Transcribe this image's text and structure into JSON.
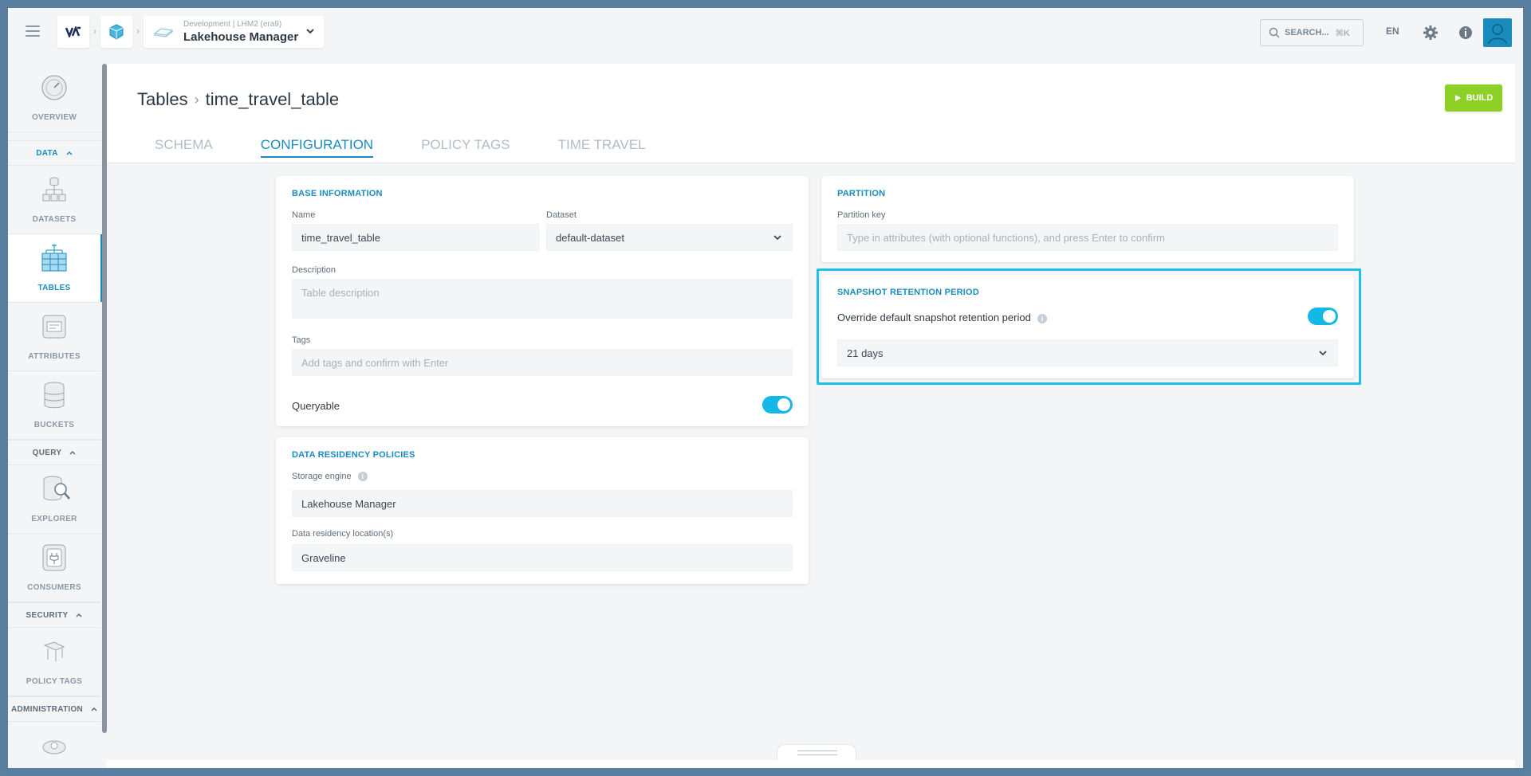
{
  "topbar": {
    "environment": "Development | LHM2 (era9)",
    "project": "Lakehouse Manager",
    "search_placeholder": "SEARCH...",
    "search_shortcut": "⌘K",
    "language": "EN"
  },
  "sidebar": {
    "items": [
      {
        "label": "OVERVIEW"
      },
      {
        "label": "DATASETS"
      },
      {
        "label": "TABLES"
      },
      {
        "label": "ATTRIBUTES"
      },
      {
        "label": "BUCKETS"
      },
      {
        "label": "EXPLORER"
      },
      {
        "label": "CONSUMERS"
      },
      {
        "label": "POLICY TAGS"
      }
    ],
    "sections": {
      "data": "DATA",
      "query": "QUERY",
      "security": "SECURITY",
      "administration": "ADMINISTRATION"
    }
  },
  "page": {
    "breadcrumb_root": "Tables",
    "breadcrumb_current": "time_travel_table",
    "build_label": "BUILD",
    "tabs": [
      {
        "label": "SCHEMA"
      },
      {
        "label": "CONFIGURATION"
      },
      {
        "label": "POLICY TAGS"
      },
      {
        "label": "TIME TRAVEL"
      }
    ]
  },
  "base_info": {
    "title": "BASE INFORMATION",
    "name_label": "Name",
    "name_value": "time_travel_table",
    "dataset_label": "Dataset",
    "dataset_value": "default-dataset",
    "description_label": "Description",
    "description_placeholder": "Table description",
    "tags_label": "Tags",
    "tags_placeholder": "Add tags and confirm with Enter",
    "queryable_label": "Queryable",
    "queryable": true
  },
  "residency": {
    "title": "DATA RESIDENCY POLICIES",
    "storage_label": "Storage engine",
    "storage_value": "Lakehouse Manager",
    "location_label": "Data residency location(s)",
    "location_value": "Graveline"
  },
  "partition": {
    "title": "PARTITION",
    "key_label": "Partition key",
    "key_placeholder": "Type in attributes (with optional functions), and press Enter to confirm"
  },
  "snapshot": {
    "title": "SNAPSHOT RETENTION PERIOD",
    "override_label": "Override default snapshot retention period",
    "override": true,
    "period_value": "21 days"
  },
  "colors": {
    "accent": "#1a8bbd",
    "toggle": "#14b8e6",
    "build": "#8ed126",
    "highlight": "#1cc0ea"
  }
}
